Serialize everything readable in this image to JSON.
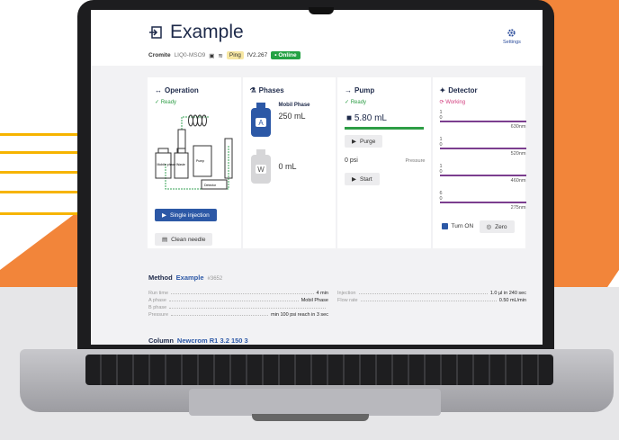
{
  "header": {
    "title": "Example",
    "brand": "Cromite",
    "device_code": "LIQ0-MSO9",
    "ping_label": "Ping",
    "version": "fV2.267",
    "online_label": "• Online",
    "settings_label": "Settings"
  },
  "operation": {
    "title": "Operation",
    "status": "✓ Ready",
    "schematic_labels": [
      "Mobile phase",
      "Waste",
      "Pump",
      "Detector"
    ],
    "single_injection_label": "Single injection",
    "clean_needle_label": "Clean needle"
  },
  "phases": {
    "title": "Phases",
    "a_badge": "A",
    "a_label": "Mobil Phase",
    "a_volume": "250 mL",
    "w_badge": "W",
    "w_volume": "0 mL"
  },
  "pump": {
    "title": "Pump",
    "status": "✓ Ready",
    "volume": "5.80 mL",
    "purge_label": "Purge",
    "pressure_value": "0 psi",
    "pressure_label": "Pressure",
    "start_label": "Start"
  },
  "detector": {
    "title": "Detector",
    "status": "⟳ Working",
    "channels": [
      {
        "top": "1",
        "bottom": "0",
        "nm": "630nm"
      },
      {
        "top": "1",
        "bottom": "0",
        "nm": "520nm"
      },
      {
        "top": "1",
        "bottom": "0",
        "nm": "460nm"
      },
      {
        "top": "6",
        "bottom": "0",
        "nm": "275nm"
      }
    ],
    "turn_on_label": "Turn ON",
    "zero_label": "Zero"
  },
  "method": {
    "label": "Method",
    "name": "Example",
    "number": "#3652",
    "rows_left": [
      {
        "label": "Run time",
        "value": "4 min"
      },
      {
        "label": "A phase",
        "value": "Mobil Phase"
      },
      {
        "label": "B phase",
        "value": ""
      },
      {
        "label": "Pressure",
        "value": "min 100 psi reach in 3 sec"
      }
    ],
    "rows_right": [
      {
        "label": "Injection",
        "value": "1.0 µl in 240 sec"
      },
      {
        "label": "Flow rate",
        "value": "0.50 mL/min"
      }
    ]
  },
  "column": {
    "label": "Column",
    "name": "Newcrom R1 3.2 150 3"
  },
  "colors": {
    "accent_blue": "#2c58a6",
    "ready_green": "#2d9d45",
    "working_pink": "#d13b7c",
    "detector_purple": "#7b3e8f",
    "background_orange": "#f08a3a"
  }
}
